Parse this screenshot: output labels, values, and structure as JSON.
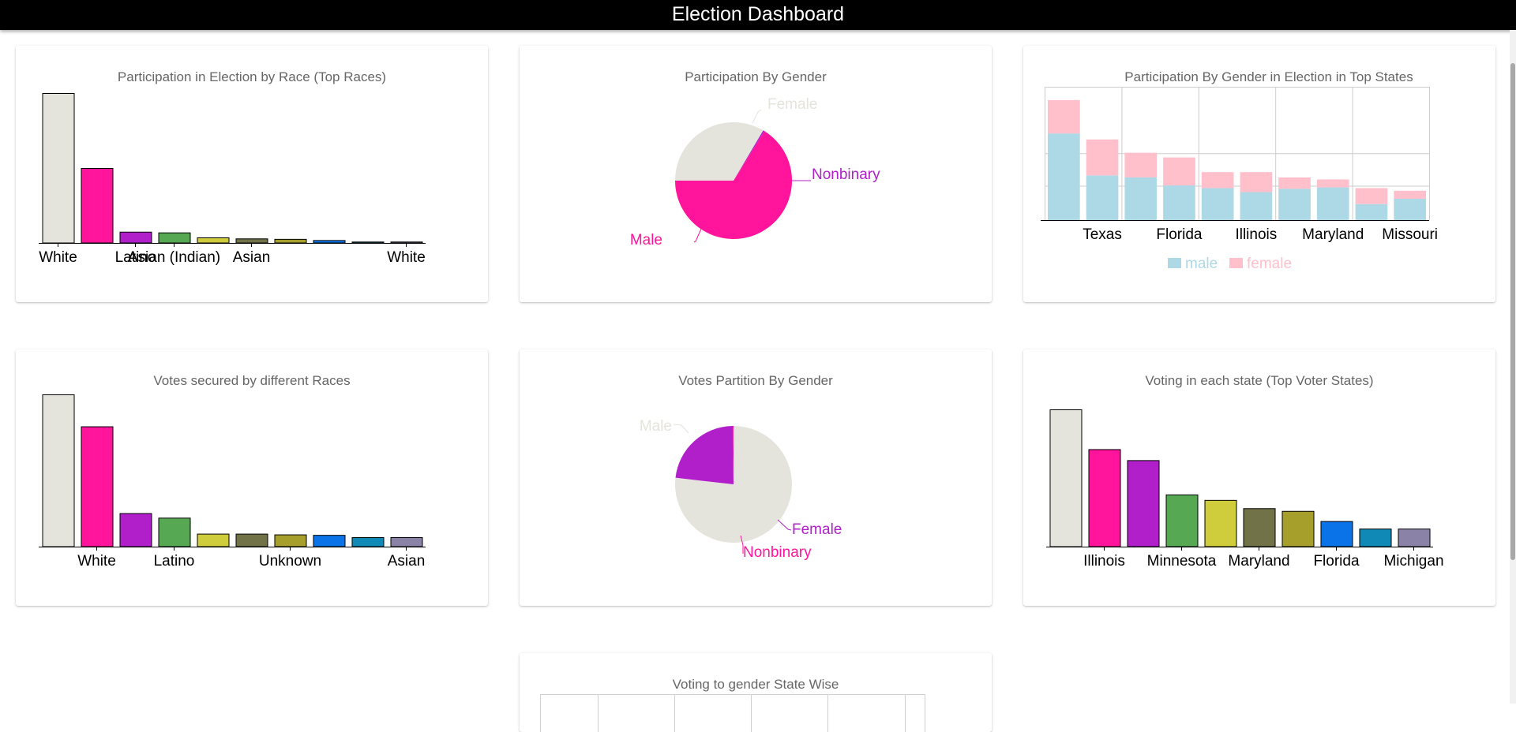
{
  "header": {
    "title": "Election Dashboard"
  },
  "colors": {
    "palette": [
      "#e4e4dc",
      "#ff149b",
      "#b01fc9",
      "#57a853",
      "#cfcd3c",
      "#727249",
      "#a69f2c",
      "#0a73e8",
      "#1089b6",
      "#8b82a8"
    ],
    "male": "#add8e6",
    "female": "#ffc0cb",
    "pie_male": "#ff149b",
    "pie_female": "#e4e4dc",
    "pie_nonbinary": "#b01fc9"
  },
  "cards": {
    "race_participation": {
      "title": "Participation in Election by Race (Top Races)"
    },
    "gender_participation": {
      "title": "Participation By Gender"
    },
    "gender_states": {
      "title": "Participation By Gender in Election in Top States"
    },
    "race_votes": {
      "title": "Votes secured by different Races"
    },
    "gender_votes": {
      "title": "Votes Partition By Gender"
    },
    "state_votes": {
      "title": "Voting in each state (Top Voter States)"
    },
    "gender_state_table": {
      "title": "Voting to gender State Wise"
    }
  },
  "chart_data": [
    {
      "id": "race_participation",
      "type": "bar",
      "title": "Participation in Election by Race (Top Races)",
      "categories": [
        "White",
        "",
        "Latino",
        "Asian (Indian)",
        "",
        "Asian",
        "",
        "",
        "",
        "White"
      ],
      "values": [
        100,
        50,
        7.5,
        7,
        3.7,
        3,
        2.7,
        1.9,
        0.9,
        0.9
      ],
      "ylim": [
        0,
        100
      ]
    },
    {
      "id": "gender_participation",
      "type": "pie",
      "title": "Participation By Gender",
      "labels": [
        "Female",
        "Nonbinary",
        "Male"
      ],
      "values": [
        33.5,
        0.4,
        66.1
      ]
    },
    {
      "id": "gender_states",
      "type": "bar",
      "stacked": true,
      "title": "Participation By Gender in Election in Top States",
      "categories": [
        "",
        "Texas",
        "",
        "Florida",
        "",
        "Illinois",
        "",
        "Maryland",
        "",
        "Missouri"
      ],
      "series": [
        {
          "name": "male",
          "values": [
            130,
            67,
            64,
            52,
            48,
            42,
            47,
            49,
            24,
            32
          ]
        },
        {
          "name": "female",
          "values": [
            50,
            54,
            37,
            42,
            24,
            30,
            17,
            12,
            24,
            12
          ]
        }
      ],
      "ylim": [
        0,
        200
      ],
      "grid": true,
      "legend": "bottom"
    },
    {
      "id": "race_votes",
      "type": "bar",
      "title": "Votes secured by different Races",
      "categories": [
        "",
        "White",
        "",
        "Latino",
        "",
        "",
        "Unknown",
        "",
        "",
        "Asian"
      ],
      "values": [
        100,
        79,
        22,
        19,
        8.5,
        8.5,
        8,
        7.7,
        6.2,
        6.2
      ],
      "ylim": [
        0,
        100
      ]
    },
    {
      "id": "gender_votes",
      "type": "pie",
      "title": "Votes Partition By Gender",
      "labels": [
        "Male",
        "Female",
        "Nonbinary"
      ],
      "values": [
        76.8,
        23,
        0.2
      ]
    },
    {
      "id": "state_votes",
      "type": "bar",
      "title": "Voting in each state (Top Voter States)",
      "categories": [
        "",
        "Illinois",
        "",
        "Minnesota",
        "",
        "Maryland",
        "",
        "Florida",
        "",
        "Michigan"
      ],
      "values": [
        100,
        71,
        63,
        38,
        34,
        28,
        26,
        18.6,
        13.1,
        13.1
      ],
      "ylim": [
        0,
        100
      ]
    }
  ]
}
